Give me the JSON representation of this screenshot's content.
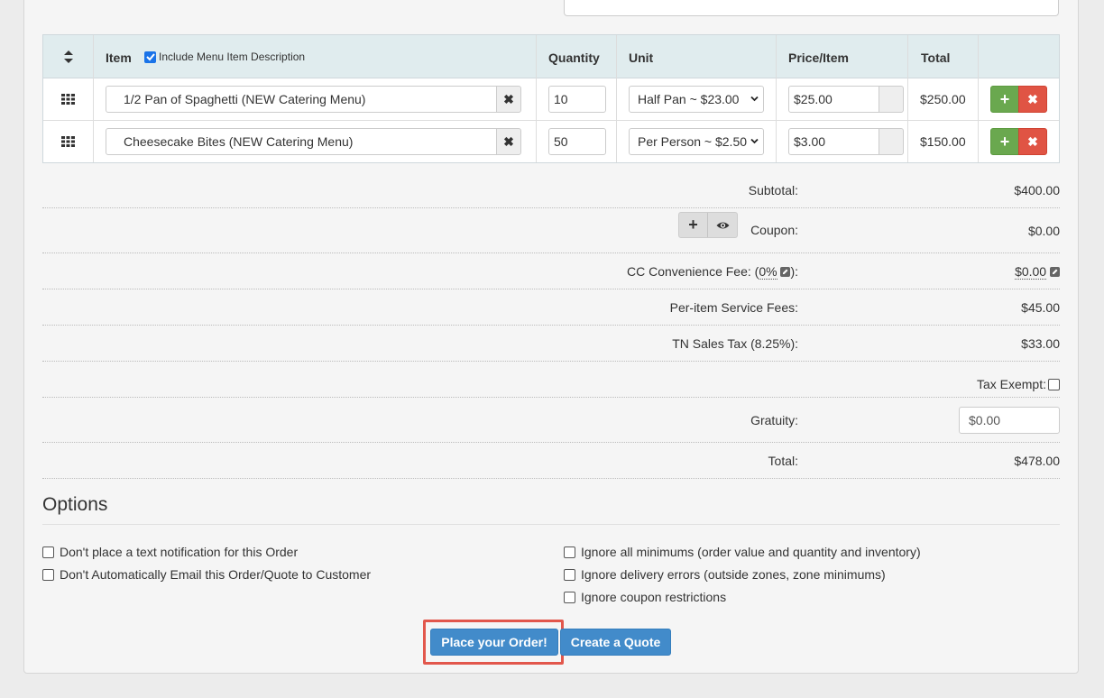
{
  "table": {
    "headers": {
      "item": "Item",
      "include_desc": "Include Menu Item Description",
      "include_desc_checked": true,
      "quantity": "Quantity",
      "unit": "Unit",
      "price": "Price/Item",
      "total": "Total"
    },
    "rows": [
      {
        "item": "1/2 Pan of Spaghetti (NEW Catering Menu)",
        "quantity": "10",
        "unit": "Half Pan ~ $23.00",
        "price": "$25.00",
        "total": "$250.00"
      },
      {
        "item": "Cheesecake Bites (NEW Catering Menu)",
        "quantity": "50",
        "unit": "Per Person ~ $2.50",
        "price": "$3.00",
        "total": "$150.00"
      }
    ]
  },
  "summary": {
    "subtotal_label": "Subtotal:",
    "subtotal": "$400.00",
    "coupon_label": "Coupon:",
    "coupon": "$0.00",
    "cc_fee_prefix": "CC Convenience Fee: (",
    "cc_fee_pct": "0%",
    "cc_fee_suffix": "):",
    "cc_fee": "$0.00",
    "service_label": "Per-item Service Fees:",
    "service": "$45.00",
    "tax_label": "TN Sales Tax (8.25%):",
    "tax": "$33.00",
    "tax_exempt_label": "Tax Exempt:",
    "gratuity_label": "Gratuity:",
    "gratuity": "$0.00",
    "total_label": "Total:",
    "total": "$478.00"
  },
  "options": {
    "title": "Options",
    "left": [
      "Don't place a text notification for this Order",
      "Don't Automatically Email this Order/Quote to Customer"
    ],
    "right": [
      "Ignore all minimums (order value and quantity and inventory)",
      "Ignore delivery errors (outside zones, zone minimums)",
      "Ignore coupon restrictions"
    ]
  },
  "actions": {
    "place_order": "Place your Order!",
    "create_quote": "Create a Quote"
  },
  "colors": {
    "primary": "#428bca",
    "success": "#6aa84f",
    "danger": "#e05444",
    "highlight": "#e2574c"
  }
}
